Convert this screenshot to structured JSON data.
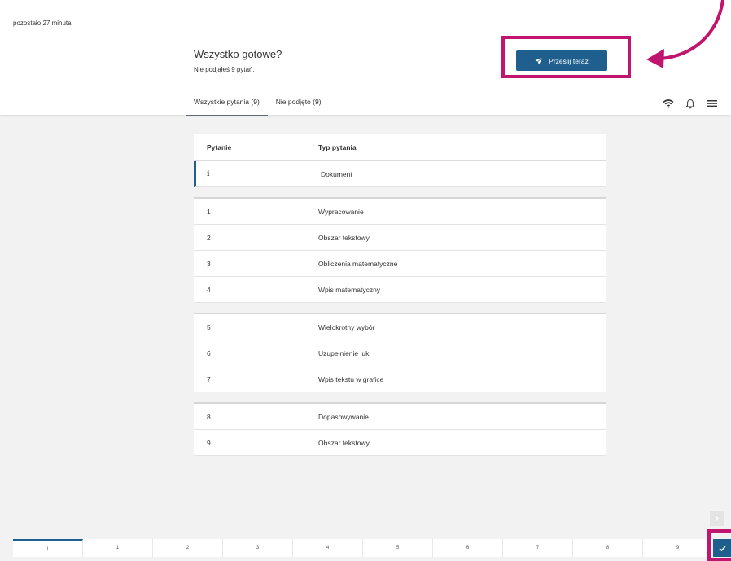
{
  "header": {
    "time_left": "pozostało 27 minuta",
    "title": "Wszystko gotowe?",
    "subtitle": "Nie podjąłeś 9 pytań.",
    "submit_label": "Prześlij teraz",
    "submit_icon": "paper-plane-icon"
  },
  "tabs": [
    {
      "label": "Wszystkie pytania (9)",
      "active": true
    },
    {
      "label": "Nie podjęto (9)",
      "active": false
    }
  ],
  "tools": [
    {
      "name": "wifi-icon"
    },
    {
      "name": "bell-icon"
    },
    {
      "name": "menu-icon"
    }
  ],
  "table": {
    "headers": {
      "question": "Pytanie",
      "type": "Typ pytania"
    },
    "groups": [
      [
        {
          "q": "i",
          "type": "Dokument"
        }
      ],
      [
        {
          "q": "1",
          "type": "Wypracowanie"
        },
        {
          "q": "2",
          "type": "Obszar tekstowy"
        },
        {
          "q": "3",
          "type": "Obliczenia matematyczne"
        },
        {
          "q": "4",
          "type": "Wpis matematyczny"
        }
      ],
      [
        {
          "q": "5",
          "type": "Wielokrotny wybór"
        },
        {
          "q": "6",
          "type": "Uzupełnienie luki"
        },
        {
          "q": "7",
          "type": "Wpis tekstu w grafice"
        }
      ],
      [
        {
          "q": "8",
          "type": "Dopasowywanie"
        },
        {
          "q": "9",
          "type": "Obszar tekstowy"
        }
      ]
    ]
  },
  "bottom_nav": {
    "items": [
      "i",
      "1",
      "2",
      "3",
      "4",
      "5",
      "6",
      "7",
      "8",
      "9"
    ],
    "active_index": 0
  },
  "colors": {
    "accent": "#1e5f8e",
    "highlight": "#c0166f"
  }
}
